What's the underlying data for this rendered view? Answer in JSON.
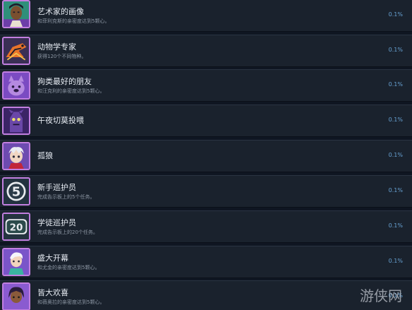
{
  "achievements": [
    {
      "title": "艺术家的画像",
      "description": "和菲利克斯的亲密度达到5颗心。",
      "percent": "0.1%",
      "icon": "felix-portrait-icon"
    },
    {
      "title": "动物学专家",
      "description": "获得120个不同物种。",
      "percent": "0.1%",
      "icon": "orange-creature-icon"
    },
    {
      "title": "狗类最好的朋友",
      "description": "和汪克利的亲密度达到5颗心。",
      "percent": "0.1%",
      "icon": "dog-friend-icon"
    },
    {
      "title": "午夜切莫投喂",
      "description": "",
      "percent": "0.1%",
      "icon": "night-creature-icon"
    },
    {
      "title": "孤狼",
      "description": "",
      "percent": "0.1%",
      "icon": "lone-wolf-icon"
    },
    {
      "title": "新手巡护员",
      "description": "完成告示板上的5个任务。",
      "percent": "0.1%",
      "icon": "number-5-icon",
      "badge": "5"
    },
    {
      "title": "学徒巡护员",
      "description": "完成告示板上的20个任务。",
      "percent": "0.1%",
      "icon": "number-20-icon",
      "badge": "20"
    },
    {
      "title": "盛大开幕",
      "description": "和尤金的亲密度达到5颗心。",
      "percent": "0.1%",
      "icon": "eugene-portrait-icon"
    },
    {
      "title": "皆大欢喜",
      "description": "和薇奥拉的亲密度达到5颗心。",
      "percent": "0.1%",
      "icon": "viola-portrait-icon"
    }
  ],
  "watermark": "游侠网",
  "colors": {
    "background": "#0f1622",
    "row": "#1a222d",
    "percent": "#67a1d2",
    "icon_frame": "#c27fe0",
    "icon_fill": "#5b2f93"
  }
}
